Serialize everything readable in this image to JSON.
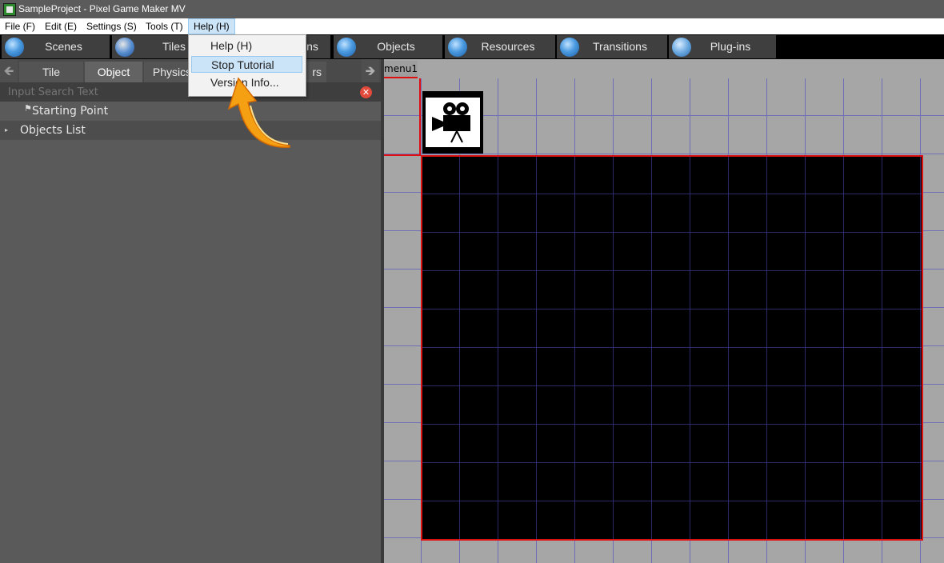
{
  "window": {
    "title": "SampleProject - Pixel Game Maker MV"
  },
  "menubar": {
    "items": [
      "File (F)",
      "Edit (E)",
      "Settings (S)",
      "Tools (T)",
      "Help (H)"
    ]
  },
  "help_menu": {
    "items": [
      "Help (H)",
      "Stop Tutorial",
      "Version Info..."
    ]
  },
  "toolbar": {
    "buttons": [
      "Scenes",
      "Tiles",
      "Animations",
      "Objects",
      "Resources",
      "Transitions",
      "Plug-ins"
    ],
    "visible_labels": {
      "scenes": "Scenes",
      "tiles": "Tiles",
      "animations_tail": "ns",
      "objects": "Objects",
      "resources": "Resources",
      "transitions": "Transitions",
      "plugins": "Plug-ins"
    }
  },
  "left_panel": {
    "tabs": [
      "Tile",
      "Object",
      "Physics",
      "rs"
    ],
    "active_tab": "Object",
    "search_placeholder": "Input Search Text",
    "tree": {
      "starting_point": "Starting Point",
      "objects_list": "Objects List"
    }
  },
  "scene": {
    "tab_label": "menu1"
  },
  "colors": {
    "accent_red": "#dd1111",
    "grid_blue": "#6f6fb8",
    "highlight": "#cce4f7"
  }
}
